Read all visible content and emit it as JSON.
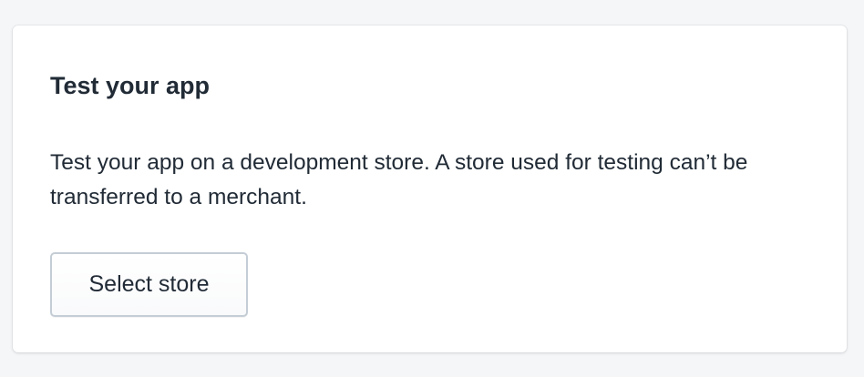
{
  "card": {
    "title": "Test your app",
    "description": "Test your app on a development store. A store used for testing can’t be transferred to a merchant.",
    "button_label": "Select store"
  }
}
